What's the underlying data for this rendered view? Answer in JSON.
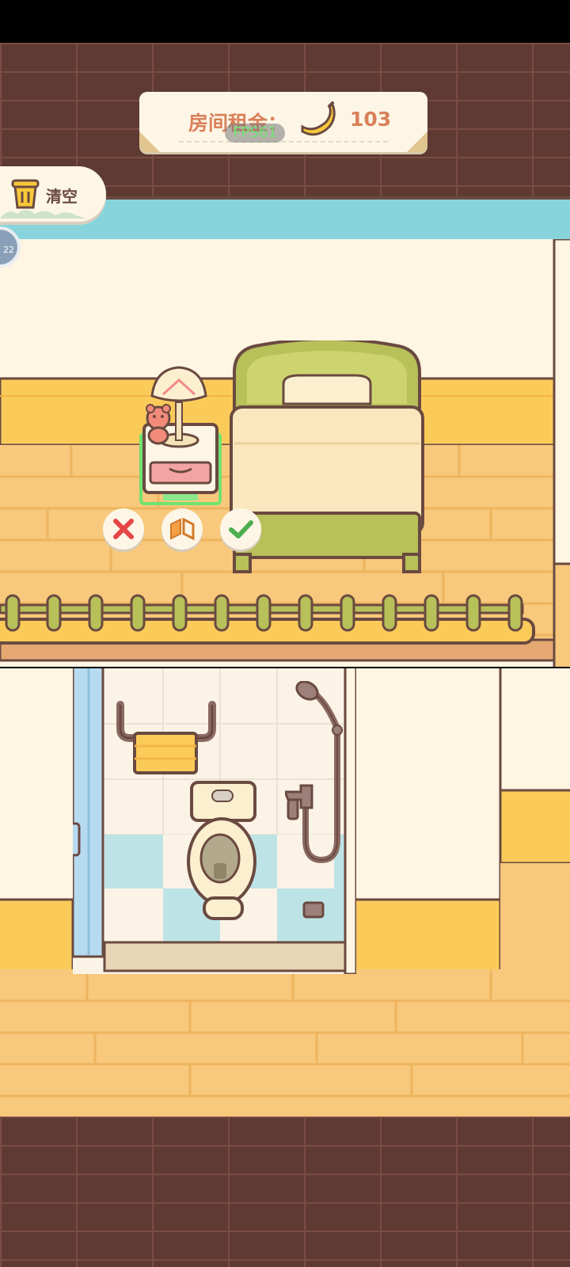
{
  "hud": {
    "rent_label": "房间租金：",
    "rent_value": "103",
    "currency_icon": "banana-icon",
    "fps_label": "FPS61"
  },
  "toolbar": {
    "clear_label": "清空",
    "clear_icon": "trash-bin-icon",
    "stage_badge": "22"
  },
  "placement_actions": {
    "cancel_icon": "close-icon",
    "flip_icon": "flip-icon",
    "confirm_icon": "check-icon"
  },
  "colors": {
    "brick": "#5e3a33",
    "floor": "#f8c87c",
    "wall": "#fef5e2",
    "accent_orange": "#d9805a",
    "bed_green": "#b8c05a",
    "cancel_red": "#e54545",
    "confirm_green": "#4caf50",
    "ceiling_blue": "#88d4dc"
  }
}
